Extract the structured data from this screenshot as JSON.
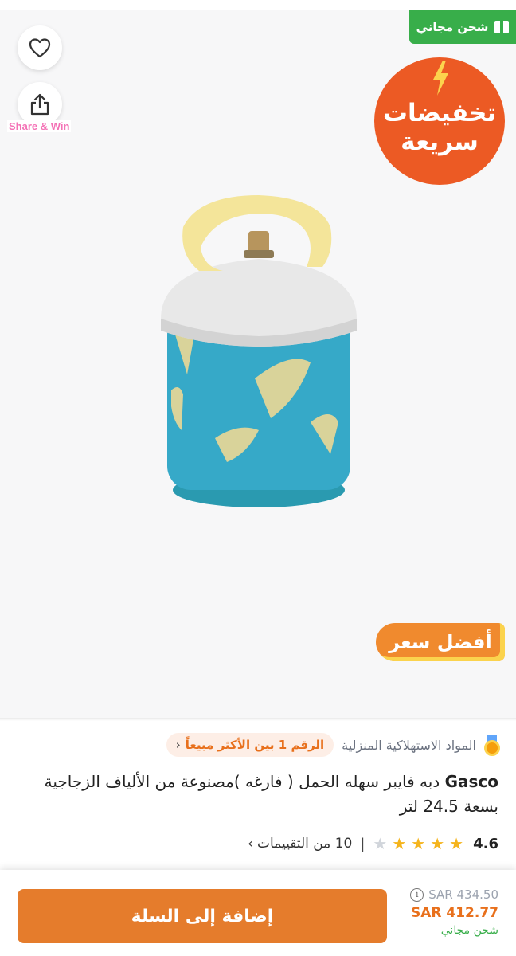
{
  "badges": {
    "free_shipping": "شحن مجاني",
    "share_win": "Share & Win",
    "flash_line1": "تخفيضات",
    "flash_line2": "سريعة",
    "best_price": "أفضل سعر"
  },
  "product": {
    "category": "المواد الاستهلاكية المنزلية",
    "bestseller": "الرقم 1 بين الأكثر مبيعاً",
    "brand": "Gasco",
    "title": "دبه فايبر سهله الحمل ( فارغه )مصنوعة من الألياف الزجاجية بسعة 24.5 لتر",
    "rating": "4.6",
    "rating_value": 4.6,
    "reviews": "10 من التقييمات"
  },
  "bottom_bar": {
    "add_to_cart": "إضافة إلى السلة",
    "old_price": "SAR 434.50",
    "new_price": "SAR 412.77",
    "shipping": "شحن مجاني"
  },
  "icons": {
    "favorite": "heart-icon",
    "share": "share-icon",
    "shipping": "box-icon",
    "flash": "lightning-icon",
    "bestseller": "medal-icon",
    "info": "info-icon"
  },
  "colors": {
    "accent": "#e57c2c",
    "flash": "#ec5a24",
    "shipping": "#38ae4a",
    "star": "#f5b41c"
  }
}
